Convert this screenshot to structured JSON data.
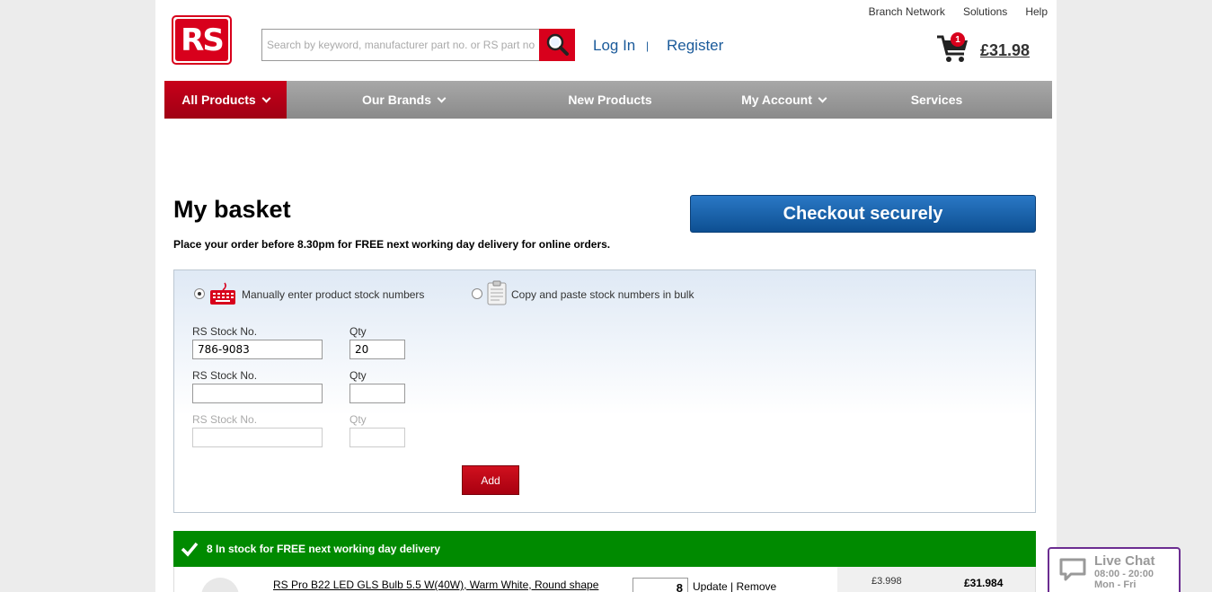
{
  "header": {
    "top_links": [
      "Branch Network",
      "Solutions",
      "Help"
    ],
    "logo_text": "RS",
    "search_placeholder": "Search by keyword, manufacturer part no. or RS part no",
    "login": "Log In",
    "separator": "|",
    "register": "Register",
    "cart_count": "1",
    "cart_total": "£31.98"
  },
  "nav": {
    "items": [
      {
        "label": "All Products"
      },
      {
        "label": "Our Brands"
      },
      {
        "label": "New Products"
      },
      {
        "label": "My Account"
      },
      {
        "label": "Services"
      }
    ]
  },
  "basket": {
    "title": "My basket",
    "subtitle": "Place your order before 8.30pm for FREE next working day delivery for online orders.",
    "checkout_label": "Checkout securely",
    "option_manual": "Manually enter product stock numbers",
    "option_bulk": "Copy and paste stock numbers in bulk",
    "stock_label": "RS Stock No.",
    "qty_label": "Qty",
    "rows": [
      {
        "stock": "786-9083",
        "qty": "20"
      },
      {
        "stock": "",
        "qty": ""
      },
      {
        "stock": "",
        "qty": ""
      }
    ],
    "add_label": "Add"
  },
  "stock_bar": {
    "text": "8 In stock for FREE next working day delivery"
  },
  "item": {
    "name": "RS Pro B22 LED GLS Bulb 5.5 W(40W), Warm White, Round shape",
    "qty": "8",
    "update": "Update",
    "remove": "Remove",
    "unit_price": "£3.998",
    "line_total": "£31.984"
  },
  "live_chat": {
    "title": "Live Chat",
    "hours": "08:00 - 20:00",
    "days": "Mon - Fri"
  },
  "colors": {
    "brand_red": "#d8001c",
    "link_blue": "#1a5a9a",
    "checkout_blue": "#0d4f92",
    "stock_green": "#008a00",
    "chat_purple": "#6b2d91"
  }
}
